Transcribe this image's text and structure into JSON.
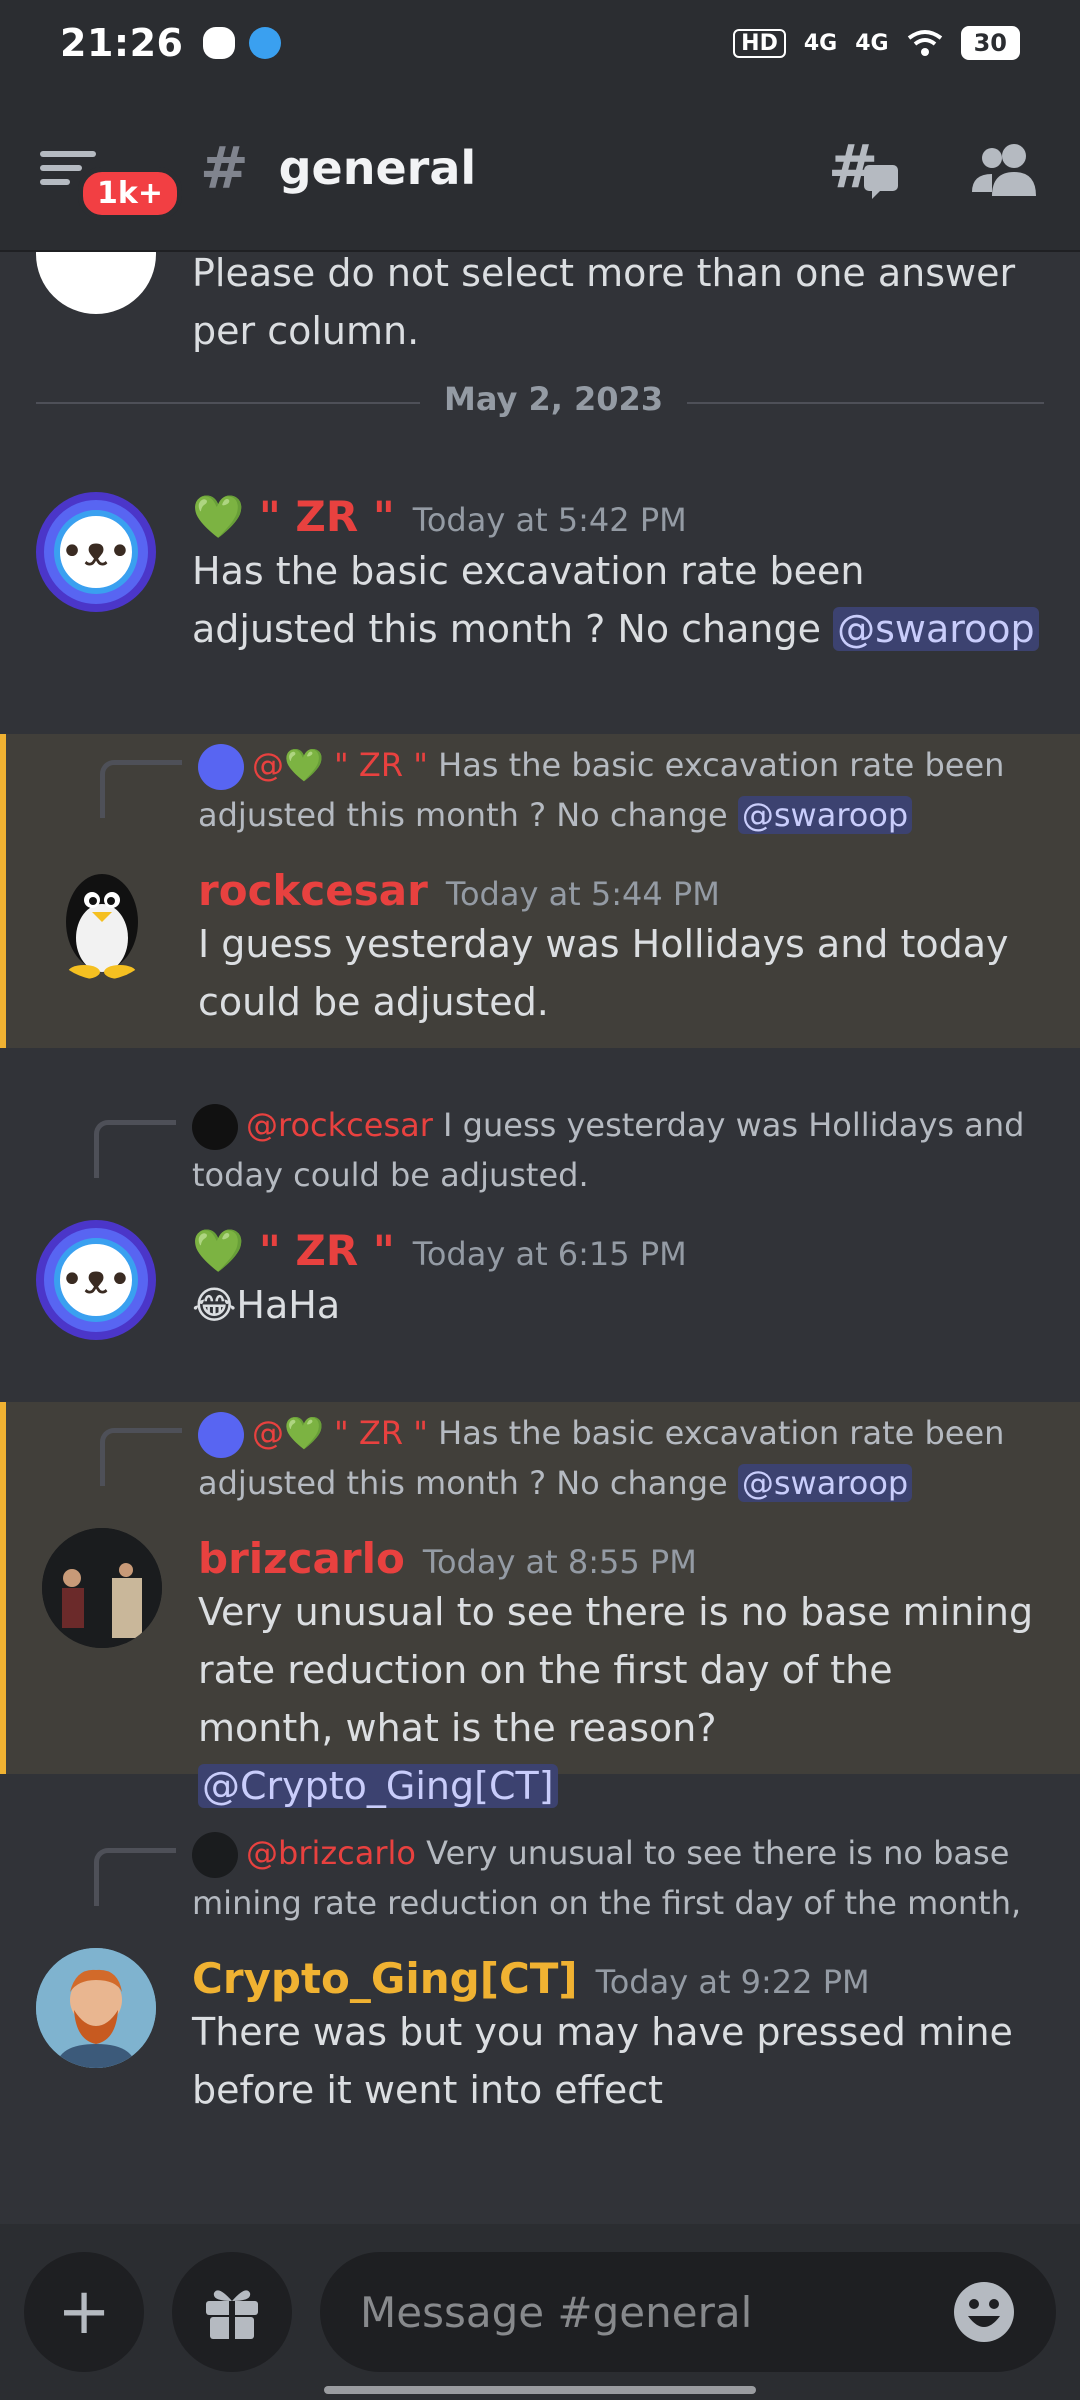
{
  "status_bar": {
    "time": "21:26",
    "battery": "30",
    "signal_1": "4G",
    "signal_2": "4G",
    "hd": "HD"
  },
  "header": {
    "badge": "1k+",
    "channel": "general"
  },
  "messages": {
    "partial_text": "Please do not select more than one answer per column.",
    "date_divider": "May 2, 2023",
    "m1": {
      "name": "\" ZR \"",
      "time": "Today at 5:42 PM",
      "text": "Has the basic excavation rate been adjusted this month ? No change",
      "mention": "@swaroop"
    },
    "m2": {
      "reply_name": "@💚 \" ZR \"",
      "reply_text": "Has the basic excavation rate been adjusted this month ? No change",
      "reply_mention": "@swaroop",
      "name": "rockcesar",
      "time": "Today at 5:44 PM",
      "text": "I guess yesterday was Hollidays and today could be adjusted."
    },
    "m3": {
      "reply_name": "@rockcesar",
      "reply_text": "I guess yesterday was Hollidays and today could be adjusted.",
      "name": "\" ZR \"",
      "time": "Today at 6:15 PM",
      "text": "HaHa"
    },
    "m4": {
      "reply_name": "@💚 \" ZR \"",
      "reply_text": "Has the basic excavation rate been adjusted this month ? No change",
      "reply_mention": "@swaroop",
      "name": "brizcarlo",
      "time": "Today at 8:55 PM",
      "text": "Very unusual to see there is no base mining rate reduction on the first day of the month, what is the reason?",
      "mention": "@Crypto_Ging[CT]"
    },
    "m5": {
      "reply_name": "@brizcarlo",
      "reply_text": "Very unusual to see there is no base mining rate reduction on the first day of the month,",
      "name": "Crypto_Ging[CT]",
      "time": "Today at 9:22 PM",
      "text": "There was but you may have pressed mine before it went into effect"
    }
  },
  "composer": {
    "placeholder": "Message #general"
  },
  "colors": {
    "accent_red": "#e8413f",
    "accent_gold": "#f0b232",
    "mention_bg": "#3c4270"
  }
}
